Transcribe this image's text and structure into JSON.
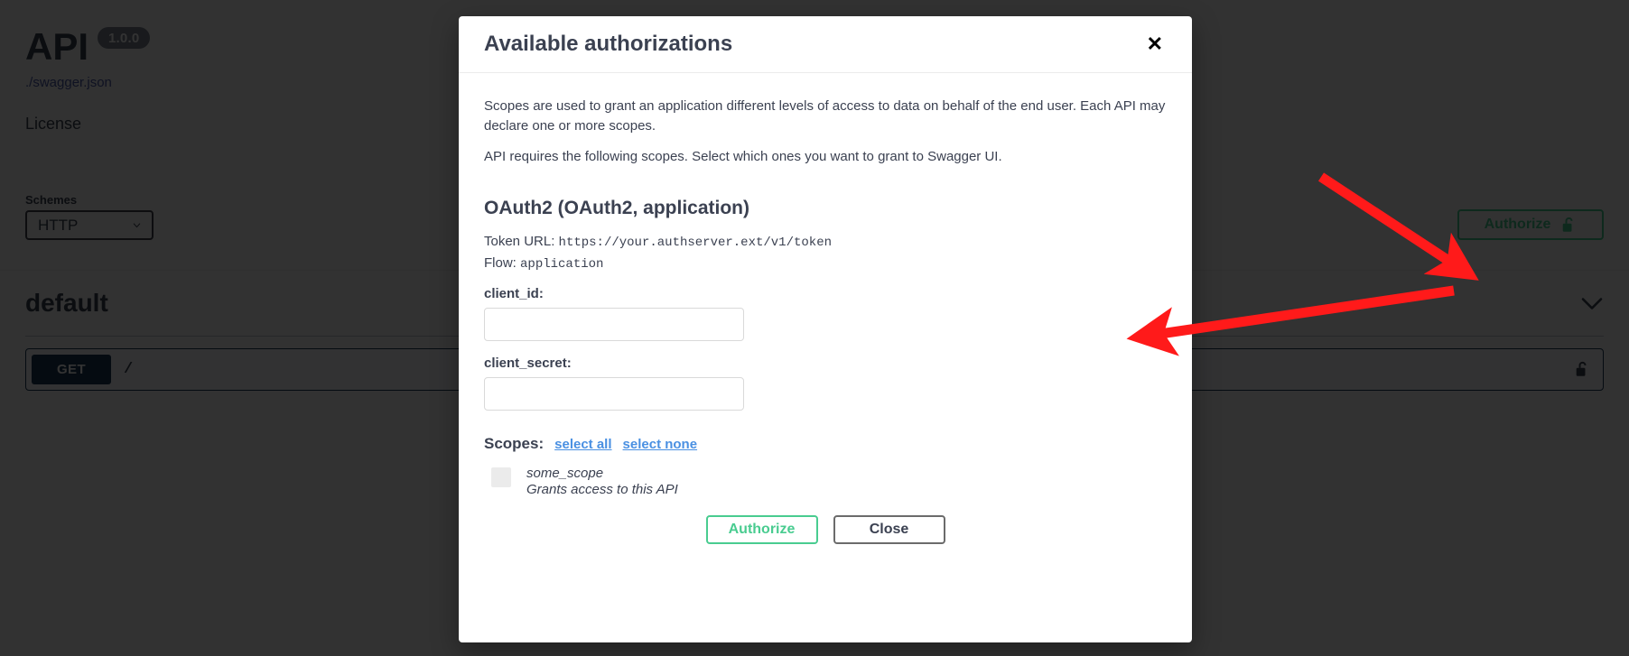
{
  "page": {
    "api_title": "API",
    "api_version": "1.0.0",
    "spec_link": "./swagger.json",
    "license_label": "License",
    "schemes_label": "Schemes",
    "scheme_selected": "HTTP",
    "authorize_button_label": "Authorize",
    "authorize_lock_icon": "unlocked-padlock-icon",
    "tag_name": "default",
    "tag_collapse_icon": "chevron-down-icon",
    "scheme_dropdown_icon": "chevron-down-icon",
    "operation": {
      "method": "GET",
      "path": "/",
      "lock_icon": "unlocked-padlock-icon"
    }
  },
  "modal": {
    "title": "Available authorizations",
    "close_icon_label": "✕",
    "description_line_1": "Scopes are used to grant an application different levels of access to data on behalf of the end user. Each API may declare one or more scopes.",
    "description_line_2": "API requires the following scopes. Select which ones you want to grant to Swagger UI.",
    "security_scheme_heading": "OAuth2 (OAuth2, application)",
    "token_url_label": "Token URL:",
    "token_url_value": "https://your.authserver.ext/v1/token",
    "flow_label": "Flow:",
    "flow_value": "application",
    "fields": [
      {
        "label": "client_id:",
        "value": "",
        "placeholder": "",
        "name": "client-id"
      },
      {
        "label": "client_secret:",
        "value": "",
        "placeholder": "",
        "name": "client-secret"
      }
    ],
    "scopes_label": "Scopes:",
    "select_all_label": "select all",
    "select_none_label": "select none",
    "scopes": [
      {
        "name": "some_scope",
        "description": "Grants access to this API",
        "checked": false
      }
    ],
    "authorize_button_label": "Authorize",
    "close_button_label": "Close"
  },
  "colors": {
    "accent_green": "#49cc90",
    "get_method_blue": "#1b3a57",
    "link_blue": "#4a90e2",
    "text": "#3b4151",
    "annotation_red": "#ff1a1a",
    "overlay": "rgba(0,0,0,0.8)"
  },
  "annotations": {
    "arrow_1_target": "authorize-button",
    "arrow_2_target": "authorizations-modal"
  }
}
